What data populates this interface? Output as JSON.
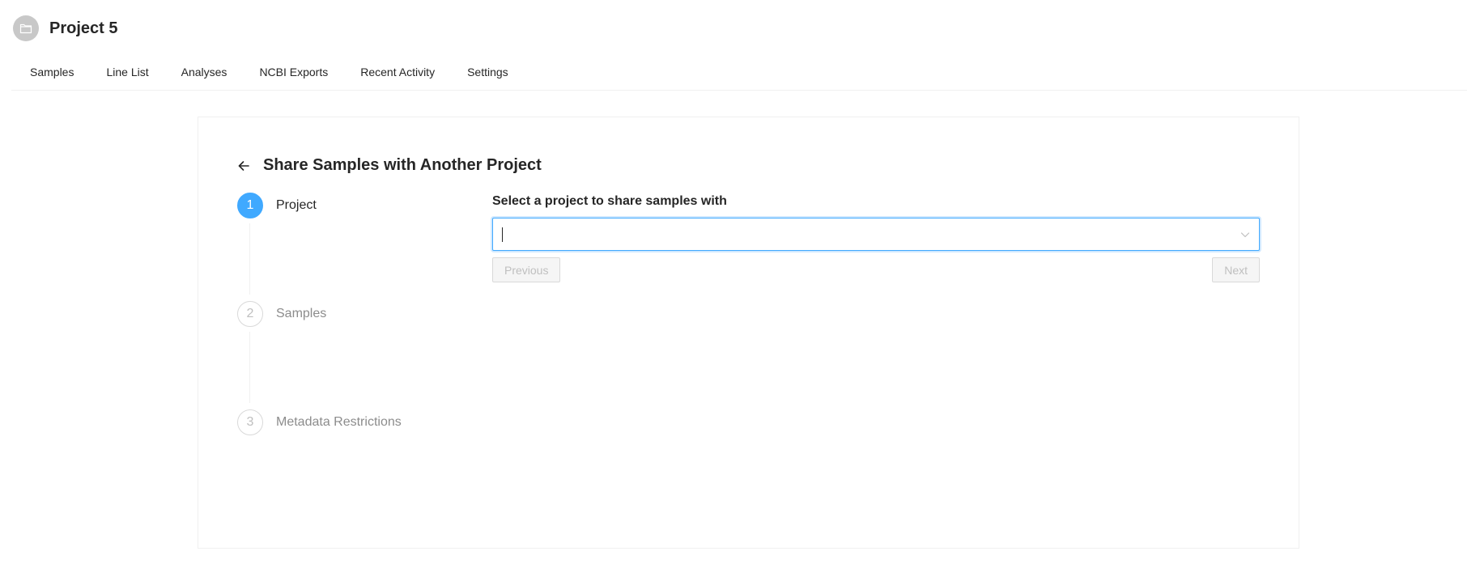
{
  "header": {
    "avatar_icon": "folder-icon",
    "title": "Project 5"
  },
  "nav": {
    "items": [
      {
        "label": "Samples"
      },
      {
        "label": "Line List"
      },
      {
        "label": "Analyses"
      },
      {
        "label": "NCBI Exports"
      },
      {
        "label": "Recent Activity"
      },
      {
        "label": "Settings"
      }
    ]
  },
  "card": {
    "back_icon": "arrow-left-icon",
    "title": "Share Samples with Another Project"
  },
  "steps": [
    {
      "number": "1",
      "label": "Project",
      "status": "active"
    },
    {
      "number": "2",
      "label": "Samples",
      "status": "waiting"
    },
    {
      "number": "3",
      "label": "Metadata Restrictions",
      "status": "waiting"
    }
  ],
  "form": {
    "label": "Select a project to share samples with",
    "select": {
      "value": "",
      "placeholder": "",
      "icon": "chevron-down-icon"
    },
    "previous_label": "Previous",
    "next_label": "Next"
  },
  "colors": {
    "accent": "#40a9ff",
    "avatar_bg": "#c8c8c8",
    "disabled_text": "#bfbfbf"
  }
}
